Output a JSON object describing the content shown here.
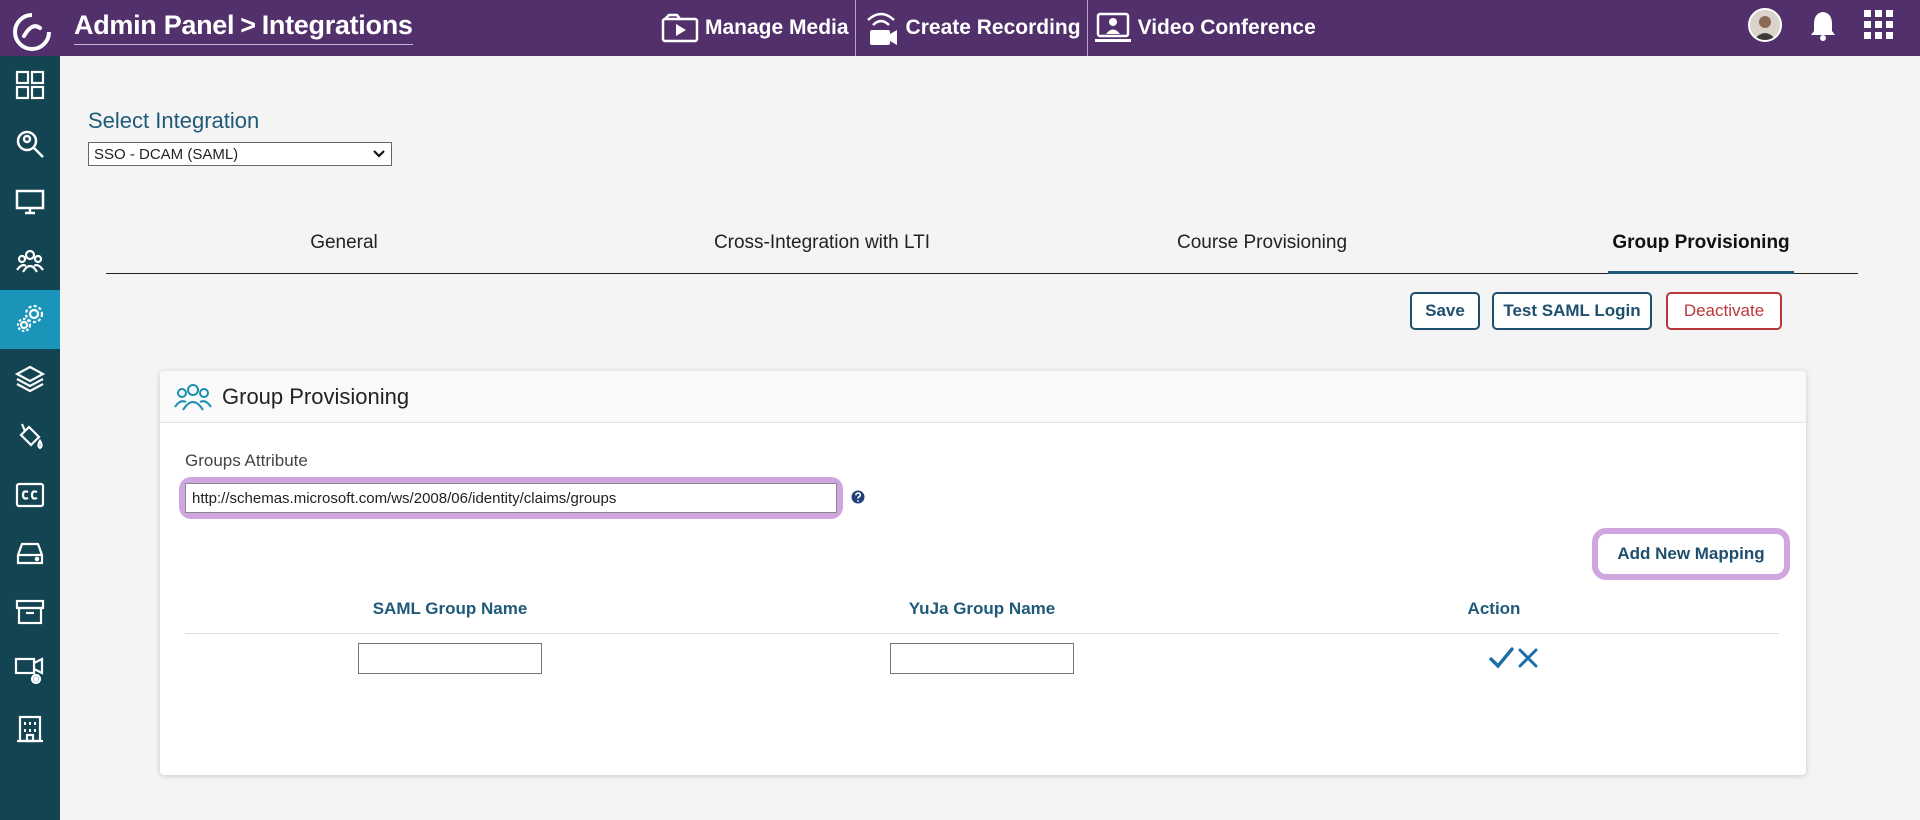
{
  "header": {
    "title_part1": "Admin Panel",
    "title_separator": ">",
    "title_part2": "Integrations",
    "nav": [
      {
        "label": "Manage Media",
        "icon": "media-icon"
      },
      {
        "label": "Create Recording",
        "icon": "recording-icon"
      },
      {
        "label": "Video Conference",
        "icon": "video-conference-icon"
      }
    ],
    "right_icons": [
      "avatar",
      "bell-icon",
      "apps-grid-icon"
    ]
  },
  "sidebar": {
    "items": [
      {
        "icon": "dashboard-icon",
        "active": false
      },
      {
        "icon": "search-icon",
        "active": false
      },
      {
        "icon": "monitor-icon",
        "active": false
      },
      {
        "icon": "groups-icon",
        "active": false
      },
      {
        "icon": "settings-gears-icon",
        "active": true
      },
      {
        "icon": "layers-icon",
        "active": false
      },
      {
        "icon": "paint-bucket-icon",
        "active": false
      },
      {
        "icon": "closed-caption-icon",
        "active": false
      },
      {
        "icon": "drive-icon",
        "active": false
      },
      {
        "icon": "archive-icon",
        "active": false
      },
      {
        "icon": "video-settings-icon",
        "active": false
      },
      {
        "icon": "building-icon",
        "active": false
      }
    ]
  },
  "integration": {
    "label": "Select Integration",
    "selected": "SSO - DCAM (SAML)"
  },
  "tabs": [
    {
      "label": "General",
      "active": false
    },
    {
      "label": "Cross-Integration with LTI",
      "active": false
    },
    {
      "label": "Course Provisioning",
      "active": false
    },
    {
      "label": "Group Provisioning",
      "active": true
    }
  ],
  "actions": {
    "save": "Save",
    "test": "Test SAML Login",
    "deactivate": "Deactivate"
  },
  "card": {
    "title": "Group Provisioning",
    "groups_attribute_label": "Groups Attribute",
    "groups_attribute_value": "http://schemas.microsoft.com/ws/2008/06/identity/claims/groups",
    "add_mapping": "Add New Mapping",
    "columns": [
      "SAML Group Name",
      "YuJa Group Name",
      "Action"
    ]
  },
  "colors": {
    "topbar": "#52306b",
    "sidebar": "#134452",
    "sidebar_active": "#1b94ba",
    "accent": "#1f5a7a",
    "highlight": "#cfa6e0",
    "danger": "#b8373a"
  }
}
